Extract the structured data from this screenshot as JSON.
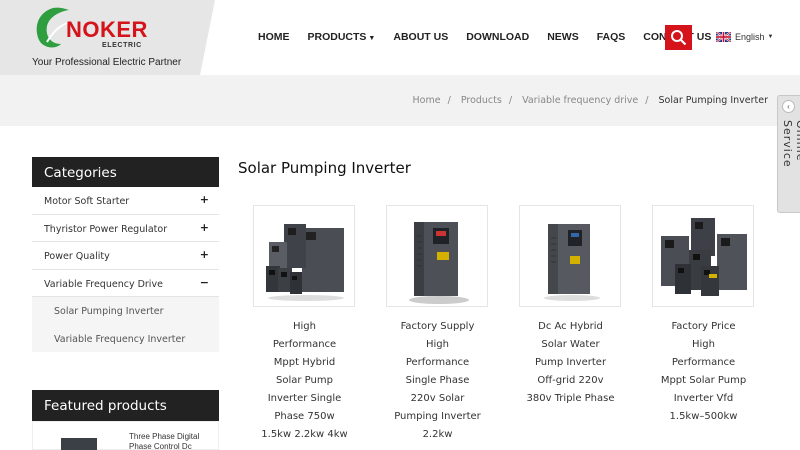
{
  "brand": {
    "name": "NOKER",
    "sub": "ELECTRIC",
    "tagline": "Your Professional Electric Partner",
    "primary_color": "#d4131b",
    "leaf_color": "#2e9e3e"
  },
  "nav": {
    "items": [
      "HOME",
      "PRODUCTS",
      "ABOUT US",
      "DOWNLOAD",
      "NEWS",
      "FAQS",
      "CONTACT US"
    ],
    "language": "English",
    "search_icon": "search-icon"
  },
  "breadcrumb": {
    "items": [
      "Home",
      "Products",
      "Variable frequency drive"
    ],
    "current": "Solar Pumping Inverter"
  },
  "online_service": "Online Service",
  "sidebar": {
    "categories_title": "Categories",
    "categories": [
      {
        "label": "Motor Soft Starter",
        "toggle": "+"
      },
      {
        "label": "Thyristor Power Regulator",
        "toggle": "+"
      },
      {
        "label": "Power Quality",
        "toggle": "+"
      },
      {
        "label": "Variable Frequency Drive",
        "toggle": "−"
      }
    ],
    "subcategories": [
      "Solar Pumping Inverter",
      "Variable Frequency Inverter"
    ],
    "featured_title": "Featured products",
    "featured": [
      {
        "text": "Three Phase Digital Phase Control Dc"
      }
    ]
  },
  "main": {
    "title": "Solar Pumping Inverter",
    "products": [
      {
        "name": "High Performance Mppt Hybrid Solar Pump Inverter Single Phase 750w 1.5kw 2.2kw 4kw"
      },
      {
        "name": "Factory Supply High Performance Single Phase 220v Solar Pumping Inverter 2.2kw"
      },
      {
        "name": "Dc Ac Hybrid Solar Water Pump Inverter Off-grid 220v 380v Triple Phase"
      },
      {
        "name": "Factory Price High Performance Mppt Solar Pump Inverter Vfd 1.5kw–500kw"
      }
    ]
  }
}
